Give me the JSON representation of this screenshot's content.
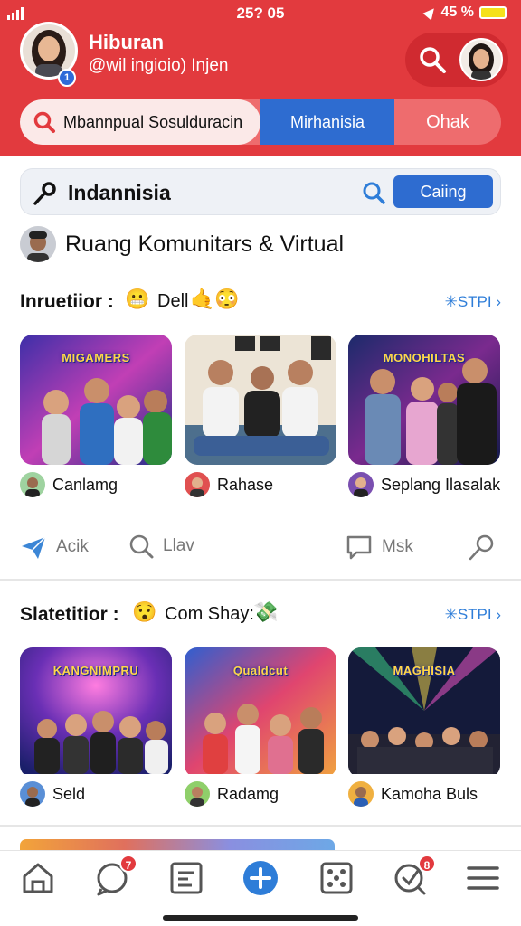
{
  "status": {
    "time": "25? 05",
    "battery": "45 %"
  },
  "profile": {
    "name": "Hiburan",
    "handle": "@wil ingioio) Injen",
    "badge": "1"
  },
  "tabs": {
    "main": "Mbannpual Sosulduracin",
    "middle": "Mirhanisia",
    "last": "Ohak"
  },
  "search": {
    "query": "Indannisia",
    "button": "Caiing"
  },
  "community": {
    "title": "Ruang Komunitars & Virtual"
  },
  "section1": {
    "label": "Inruetiior :",
    "extra": "Dell",
    "link": "✳STPI ›",
    "cards": [
      {
        "banner": "MIGAMERS",
        "author": "Canlamg"
      },
      {
        "banner": "",
        "author": "Rahase"
      },
      {
        "banner": "MONOHILTAS",
        "author": "Seplang Ilasalak"
      }
    ],
    "actions": {
      "like": "Acik",
      "search": "Llav",
      "comment": "Msk"
    }
  },
  "section2": {
    "label": "Slatetitior :",
    "extra": "Com Shay:",
    "link": "✳STPI ›",
    "cards": [
      {
        "banner": "KANGNIMPRU",
        "author": "Seld"
      },
      {
        "banner": "Qualdcut",
        "author": "Radamg"
      },
      {
        "banner": "MAGHISIA",
        "author": "Kamoha Buls"
      }
    ]
  },
  "nav": {
    "chat_badge": "7",
    "explore_badge": "8",
    "icons": [
      "home-icon",
      "chat-icon",
      "list-icon",
      "plus-icon",
      "dice-icon",
      "explore-icon",
      "menu-icon"
    ]
  },
  "colors": {
    "header": "#e23a3e",
    "accent": "#2e6cd0",
    "link": "#2e7dd8"
  }
}
